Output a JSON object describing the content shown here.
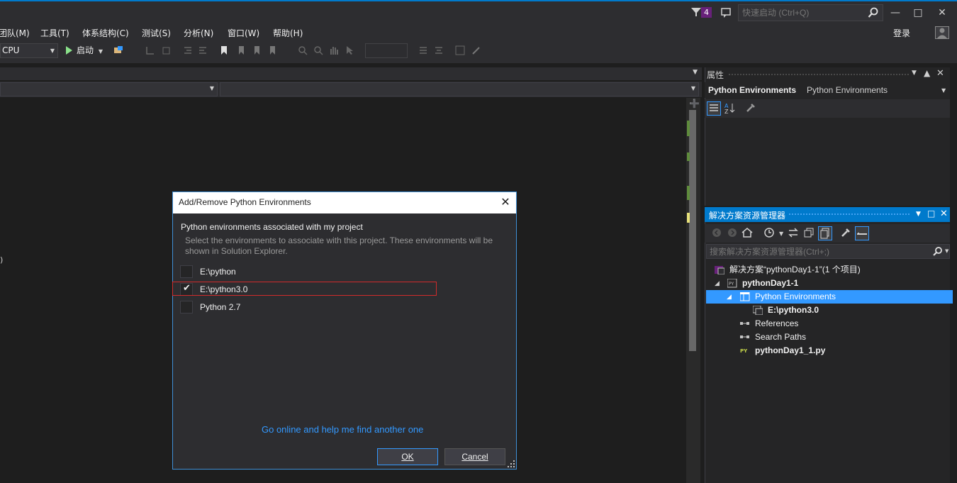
{
  "titlebar": {
    "notification_count": "4",
    "quick_launch_placeholder": "快速启动 (Ctrl+Q)"
  },
  "menu": {
    "items": [
      "团队(M)",
      "工具(T)",
      "体系结构(C)",
      "测试(S)",
      "分析(N)",
      "窗口(W)",
      "帮助(H)"
    ],
    "login": "登录"
  },
  "toolbar": {
    "platform": "CPU",
    "start_label": "启动"
  },
  "properties": {
    "title": "属性",
    "object_name": "Python Environments",
    "object_type": "Python Environments"
  },
  "solution_explorer": {
    "title": "解决方案资源管理器",
    "search_placeholder": "搜索解决方案资源管理器(Ctrl+;)",
    "tree": [
      {
        "label": "解决方案“pythonDay1-1”(1 个项目)"
      },
      {
        "label": "pythonDay1-1"
      },
      {
        "label": "Python Environments"
      },
      {
        "label": "E:\\python3.0"
      },
      {
        "label": "References"
      },
      {
        "label": "Search Paths"
      },
      {
        "label": "pythonDay1_1.py"
      }
    ]
  },
  "dialog": {
    "title": "Add/Remove Python Environments",
    "heading": "Python environments associated with my project",
    "description": "Select the environments to associate with this project. These environments will be shown in Solution Explorer.",
    "environments": [
      {
        "label": "E:\\python",
        "checked": false
      },
      {
        "label": "E:\\python3.0",
        "checked": true
      },
      {
        "label": "Python 2.7",
        "checked": false
      }
    ],
    "link": "Go online and help me find another one",
    "ok": "OK",
    "cancel": "Cancel"
  },
  "colors": {
    "accent": "#007acc",
    "highlight_border": "#d12b2b",
    "selection": "#3399ff",
    "link": "#3399ff"
  }
}
